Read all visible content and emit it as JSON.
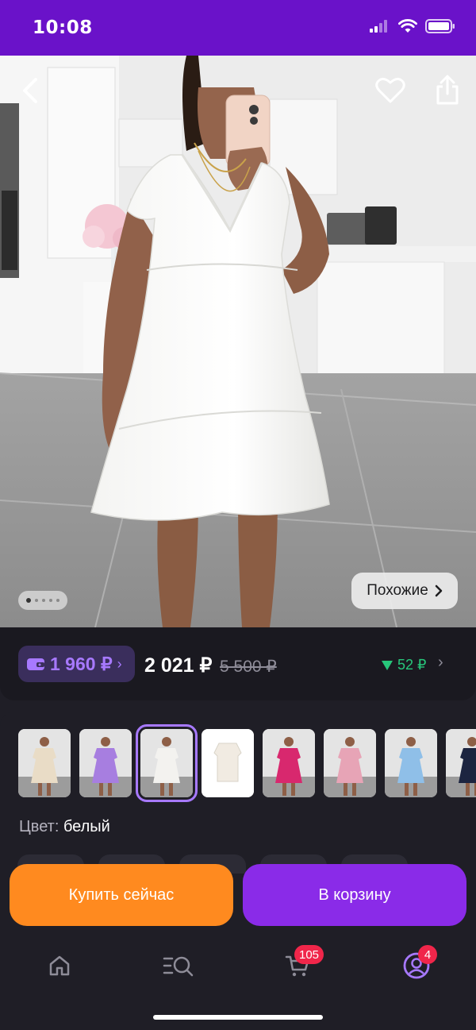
{
  "status_bar": {
    "time": "10:08"
  },
  "hero": {
    "similar_label": "Похожие",
    "pager_count": 5,
    "pager_active": 1
  },
  "pricing": {
    "wallet_price": "1 960 ₽",
    "price": "2 021 ₽",
    "old_price": "5 500 ₽",
    "cashback": "52 ₽"
  },
  "variants": {
    "thumbnails": [
      {
        "color_name": "beige",
        "dress_color": "#e9dcc6"
      },
      {
        "color_name": "lilac",
        "dress_color": "#a77ee0"
      },
      {
        "color_name": "white",
        "dress_color": "#f3f2ef",
        "selected": true
      },
      {
        "color_name": "white-flat",
        "dress_color": "#f1ebe2"
      },
      {
        "color_name": "fuchsia",
        "dress_color": "#d8286e"
      },
      {
        "color_name": "pink",
        "dress_color": "#e7a4b6"
      },
      {
        "color_name": "light-blue",
        "dress_color": "#8fbfe8"
      },
      {
        "color_name": "navy",
        "dress_color": "#1c2440"
      }
    ],
    "color_label": "Цвет:",
    "color_value": "белый"
  },
  "actions": {
    "buy_now": "Купить сейчас",
    "to_cart": "В корзину"
  },
  "bottom_nav": {
    "items": [
      {
        "name": "home",
        "icon": "home-icon"
      },
      {
        "name": "catalog",
        "icon": "catalog-search-icon"
      },
      {
        "name": "cart",
        "icon": "cart-icon",
        "badge": "105"
      },
      {
        "name": "profile",
        "icon": "profile-icon",
        "badge": "4",
        "active": true
      }
    ]
  },
  "colors": {
    "brand": "#6a12c9",
    "accent_purple": "#8a2be8",
    "accent_orange": "#ff8a1f",
    "cashback_green": "#27c67a",
    "badge_red": "#f0264a"
  }
}
